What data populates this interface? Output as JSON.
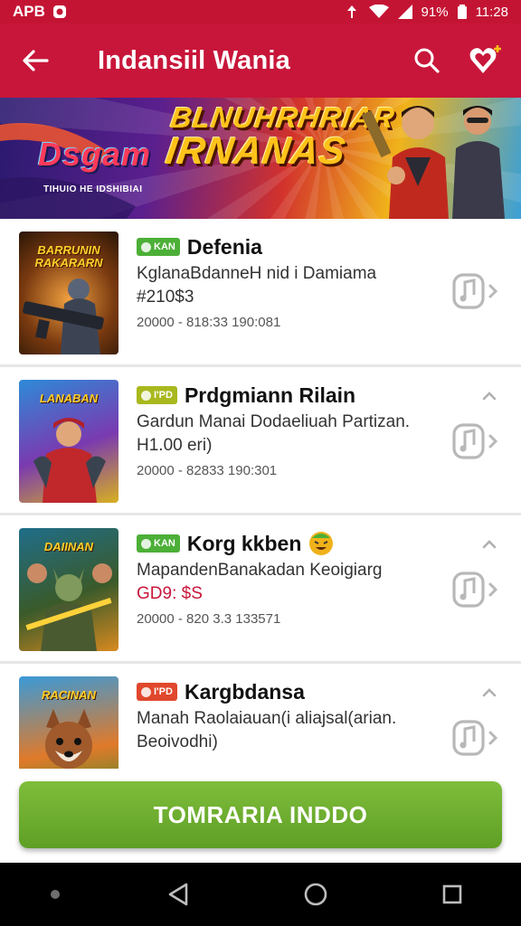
{
  "status_bar": {
    "left_text": "APB",
    "battery": "91%",
    "time": "11:28"
  },
  "app_bar": {
    "title": "Indansiil Wania",
    "back_icon": "arrow-left-icon",
    "search_icon": "search-icon",
    "fav_icon": "heart-plus-icon"
  },
  "banner": {
    "logo": "Dsgam",
    "logo_sub": "TIHUIO HE IDSHIBIAI",
    "headline_1": "BLNUHRHRIAR",
    "headline_2": "IRNANAS"
  },
  "items": [
    {
      "thumb_title": "BARRUNIN RAKARARN",
      "tag": "KAN",
      "tag_color": "#4caf37",
      "title": "Defenia",
      "desc": "KglanaBdanneH nid i Damiama",
      "price": "#210$3",
      "meta": "20000 - 818:33 190:081"
    },
    {
      "thumb_title": "LANABAN",
      "tag": "I'PD",
      "tag_color": "#a8b81e",
      "title": "Prdgmiann Rilain",
      "desc": "Gardun Manai Dodaeliuah Partizan.",
      "price": "H1.00 eri)",
      "meta": "20000 - 82833 190:301"
    },
    {
      "thumb_title": "DAIINAN",
      "tag": "KAN",
      "tag_color": "#4caf37",
      "title": "Korg kkben",
      "desc": "MapandenBanakadan Keoigiarg",
      "price": "GD9: $S",
      "meta": "20000 - 820 3.3 133571"
    },
    {
      "thumb_title": "RACINAN",
      "tag": "I'PD",
      "tag_color": "#e0472c",
      "title": "Kargbdansa",
      "desc": "Manah Raolaiauan(i aliajsal(arian.",
      "price": "Beoivodhi)",
      "meta": ""
    }
  ],
  "cta": {
    "label": "TOMRARIA INDDO"
  },
  "colors": {
    "brand": "#c8163a",
    "cta": "#6aa92d"
  },
  "nav": {
    "back": "triangle-back-icon",
    "home": "circle-home-icon",
    "recents": "square-recents-icon"
  }
}
